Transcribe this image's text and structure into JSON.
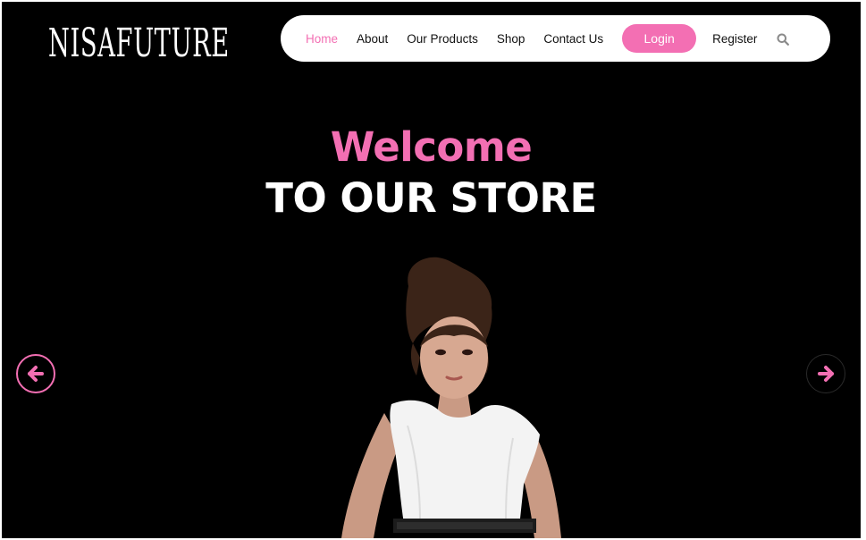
{
  "brand": {
    "logo_text": "NISAFUTURE"
  },
  "nav": {
    "links": [
      {
        "label": "Home",
        "active": true
      },
      {
        "label": "About",
        "active": false
      },
      {
        "label": "Our Products",
        "active": false
      },
      {
        "label": "Shop",
        "active": false
      },
      {
        "label": "Contact Us",
        "active": false
      }
    ],
    "login_label": "Login",
    "register_label": "Register",
    "search_icon": "search-icon"
  },
  "hero": {
    "welcome": "Welcome",
    "subtitle": "TO OUR STORE",
    "prev_icon": "arrow-left-icon",
    "next_icon": "arrow-right-icon"
  },
  "colors": {
    "accent": "#f36fb3",
    "background": "#000000",
    "nav_bg": "#ffffff",
    "text_light": "#ffffff"
  }
}
